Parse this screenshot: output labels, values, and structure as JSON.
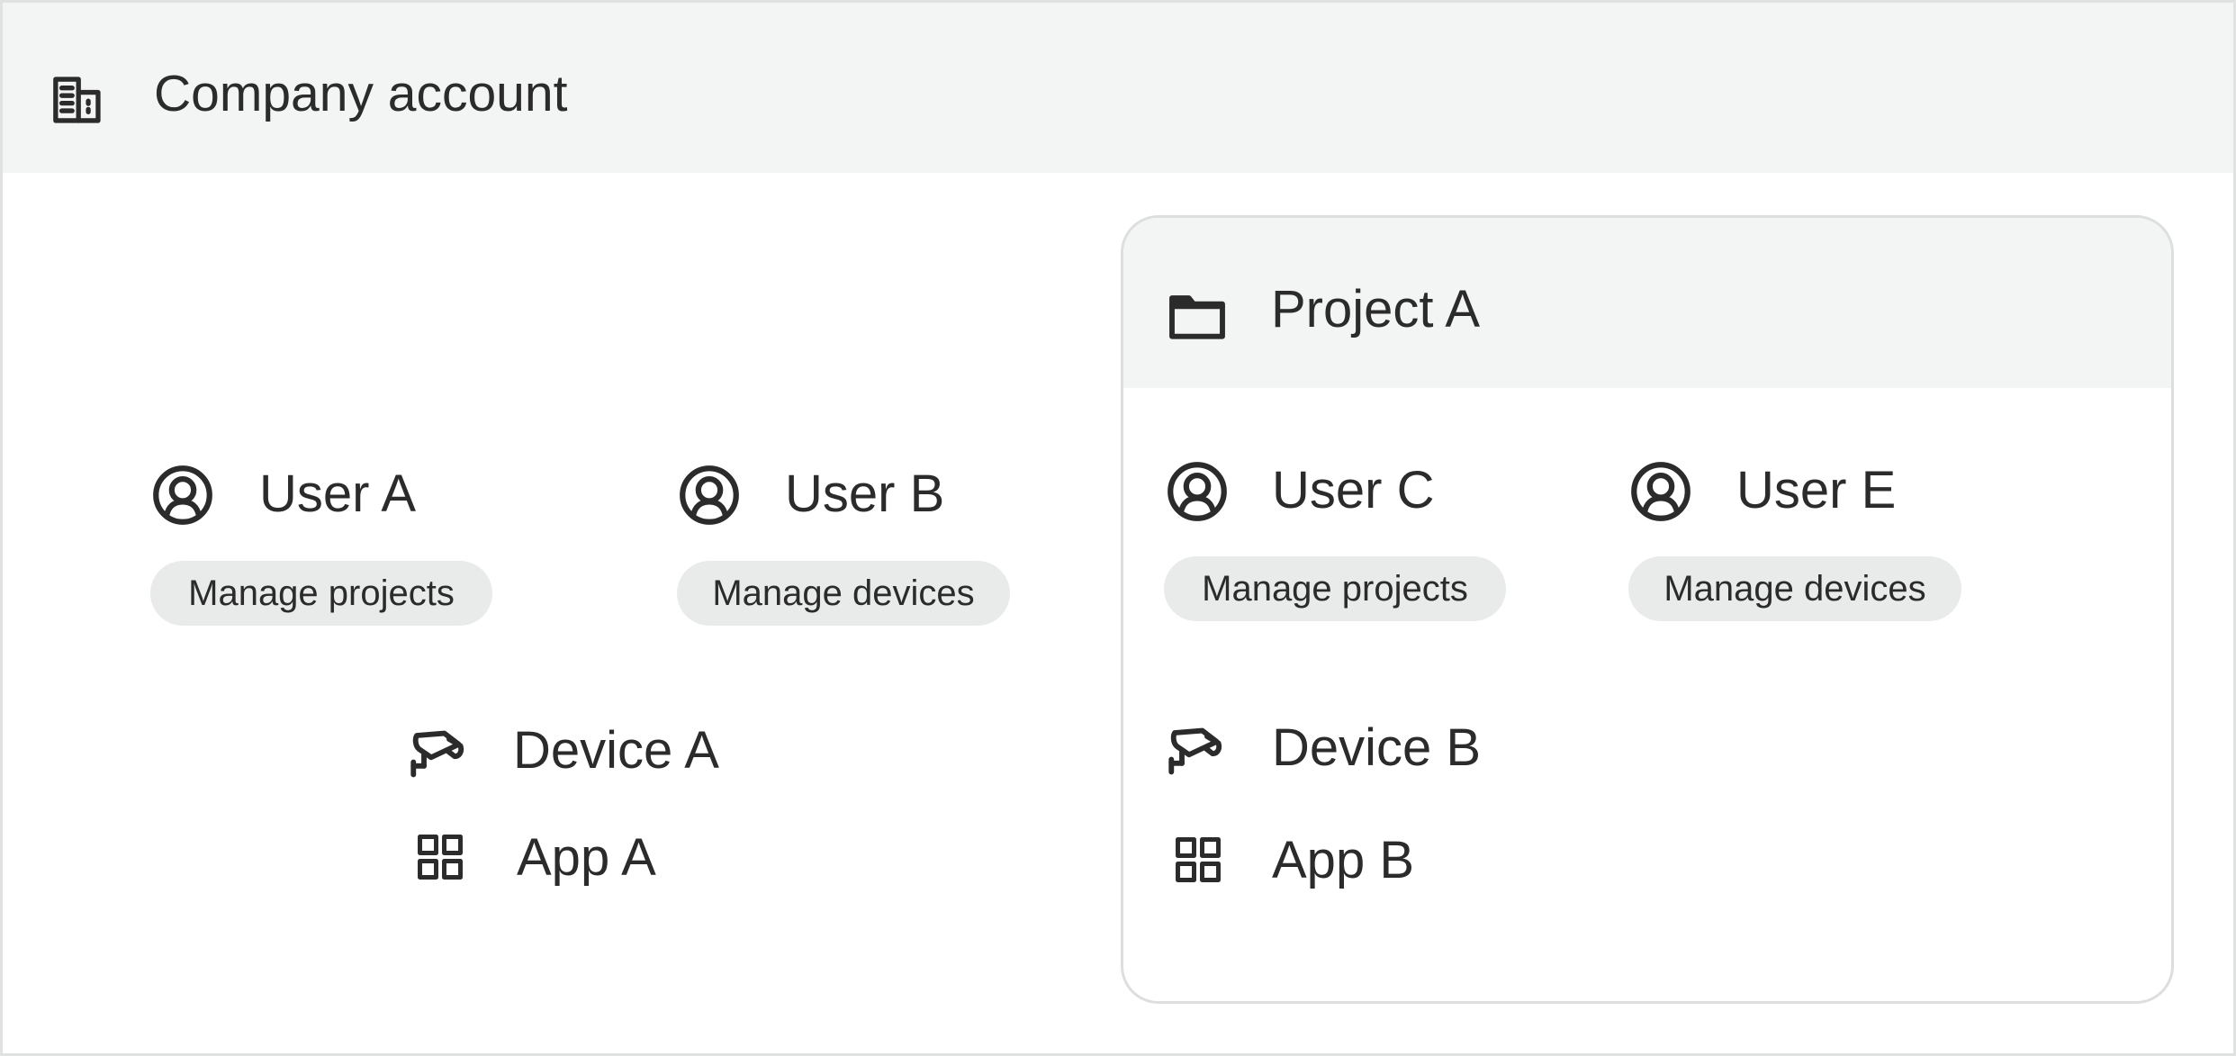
{
  "company": {
    "title": "Company account",
    "icon": "building-icon"
  },
  "users": [
    {
      "name": "User A",
      "permission": "Manage projects",
      "icon": "user-icon"
    },
    {
      "name": "User B",
      "permission": "Manage devices",
      "icon": "user-icon"
    }
  ],
  "device": {
    "name": "Device A",
    "icon": "camera-icon"
  },
  "app": {
    "name": "App A",
    "icon": "apps-grid-icon"
  },
  "project": {
    "title": "Project A",
    "icon": "folder-icon",
    "users": [
      {
        "name": "User C",
        "permission": "Manage projects",
        "icon": "user-icon"
      },
      {
        "name": "User E",
        "permission": "Manage devices",
        "icon": "user-icon"
      }
    ],
    "device": {
      "name": "Device B",
      "icon": "camera-icon"
    },
    "app": {
      "name": "App B",
      "icon": "apps-grid-icon"
    }
  },
  "colors": {
    "header_bg": "#f3f5f4",
    "pill_bg": "#e9ebea",
    "border": "#dcdfde",
    "text": "#2b2b2b"
  }
}
